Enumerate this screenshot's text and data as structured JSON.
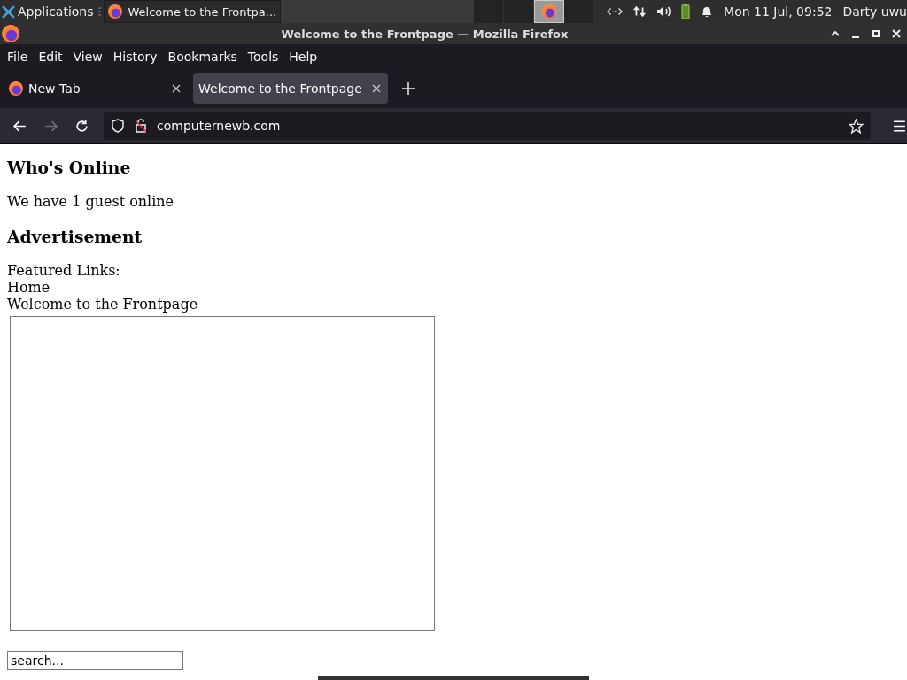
{
  "taskbar": {
    "apps_label": "Applications",
    "windows": [
      {
        "title": "Welcome to the Frontpa...",
        "selected": false
      }
    ],
    "workspaces": [
      {
        "selected": false
      },
      {
        "selected": false
      },
      {
        "selected": true
      },
      {
        "selected": false
      }
    ],
    "clock": "Mon 11 Jul, 09:52",
    "user": "Darty uwu"
  },
  "window": {
    "title": "Welcome to the Frontpage — Mozilla Firefox"
  },
  "menu": [
    {
      "label": "File"
    },
    {
      "label": "Edit"
    },
    {
      "label": "View"
    },
    {
      "label": "History"
    },
    {
      "label": "Bookmarks"
    },
    {
      "label": "Tools"
    },
    {
      "label": "Help"
    }
  ],
  "tabs": [
    {
      "label": "New Tab",
      "selected": false,
      "favicon": true
    },
    {
      "label": "Welcome to the Frontpage",
      "selected": true,
      "favicon": false
    }
  ],
  "nav": {
    "back_disabled": false,
    "forward_disabled": true,
    "url": "computernewb.com"
  },
  "page": {
    "blocks": [
      {
        "kind": "heading",
        "text": "Who's Online"
      },
      {
        "kind": "para",
        "text": "We have 1 guest online"
      },
      {
        "kind": "heading",
        "text": "Advertisement"
      },
      {
        "kind": "line",
        "text": "Featured Links:"
      },
      {
        "kind": "line",
        "text": "Home"
      },
      {
        "kind": "line",
        "text": "Welcome to the Frontpage"
      },
      {
        "kind": "frame"
      },
      {
        "kind": "search",
        "value": "search..."
      }
    ]
  }
}
